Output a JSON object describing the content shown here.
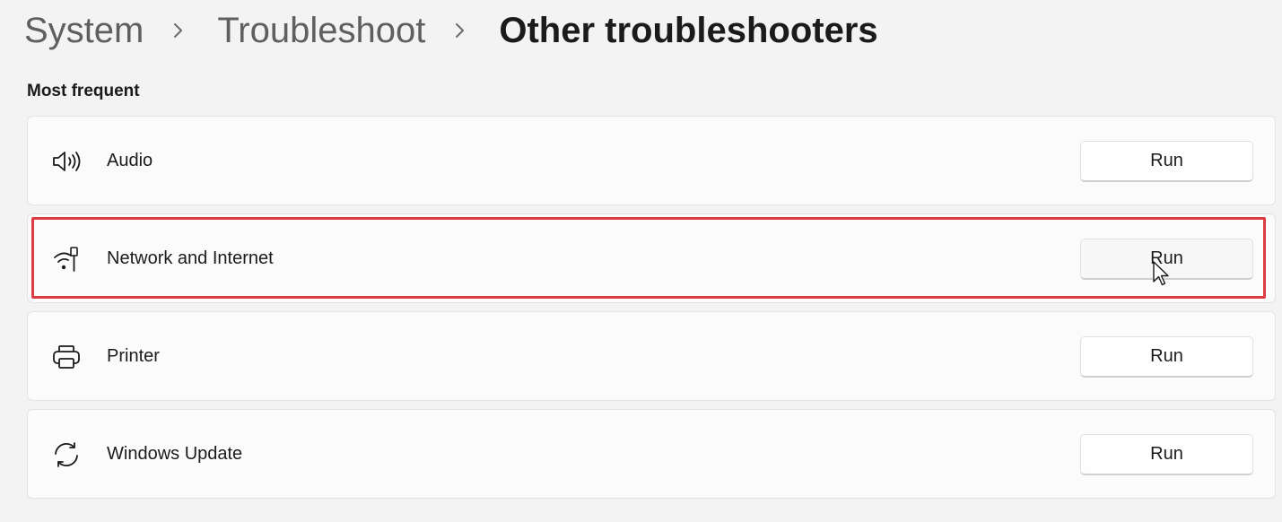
{
  "breadcrumb": {
    "items": [
      "System",
      "Troubleshoot",
      "Other troubleshooters"
    ]
  },
  "section": {
    "title": "Most frequent"
  },
  "troubleshooters": [
    {
      "label": "Audio",
      "button": "Run",
      "icon": "speaker-icon"
    },
    {
      "label": "Network and Internet",
      "button": "Run",
      "icon": "wifi-ethernet-icon"
    },
    {
      "label": "Printer",
      "button": "Run",
      "icon": "printer-icon"
    },
    {
      "label": "Windows Update",
      "button": "Run",
      "icon": "sync-arrows-icon"
    }
  ],
  "colors": {
    "background": "#f3f3f3",
    "card": "#fbfbfb",
    "highlight": "#dc3c41"
  }
}
